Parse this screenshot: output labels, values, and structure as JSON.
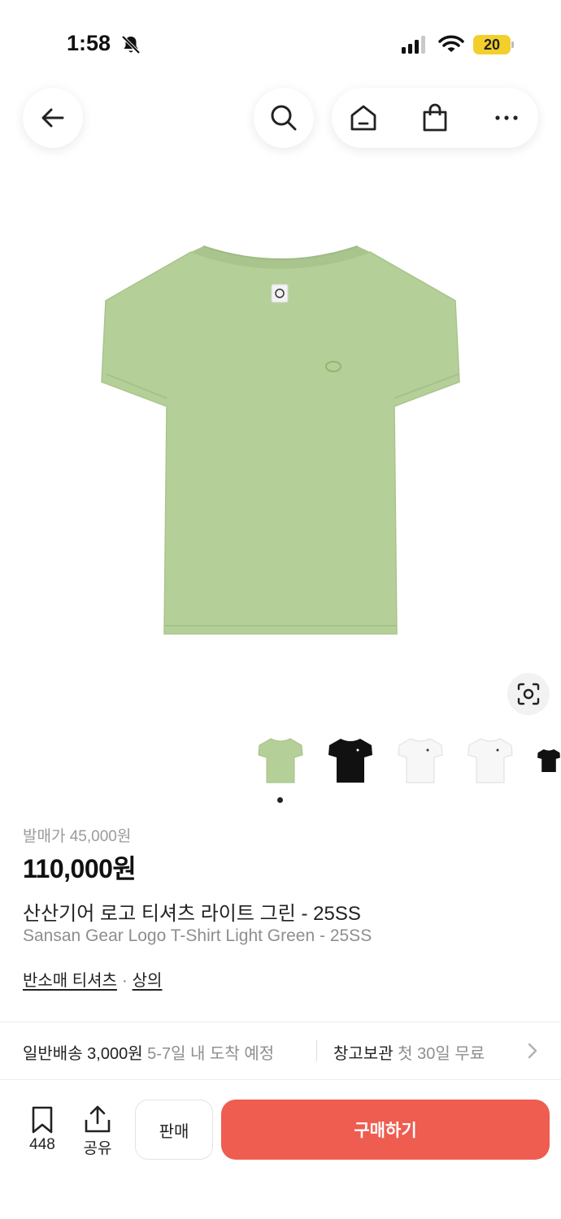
{
  "status_bar": {
    "time": "1:58",
    "battery": "20"
  },
  "nav": {
    "icons": [
      "back-arrow-icon",
      "search-icon",
      "home-icon",
      "shopping-bag-icon",
      "more-icon"
    ]
  },
  "gallery": {
    "product_color": "#b4cf98",
    "thumbnails": [
      "light-green",
      "black",
      "white",
      "white",
      "black"
    ],
    "active_index": 0
  },
  "product": {
    "original_price": "발매가 45,000원",
    "price": "110,000원",
    "title_ko": "산산기어 로고 티셔츠 라이트 그린 - 25SS",
    "title_en": "Sansan Gear Logo T-Shirt Light Green - 25SS",
    "category_1": "반소매 티셔츠",
    "category_sep": "·",
    "category_2": "상의"
  },
  "shipping": {
    "label": "일반배송 3,000원",
    "eta": "5-7일 내 도착 예정",
    "storage_label": "창고보관",
    "storage_note": "첫 30일 무료"
  },
  "bottom_bar": {
    "bookmark_count": "448",
    "share_label": "공유",
    "sell_label": "판매",
    "buy_label": "구매하기",
    "buy_color": "#ee5d50"
  }
}
